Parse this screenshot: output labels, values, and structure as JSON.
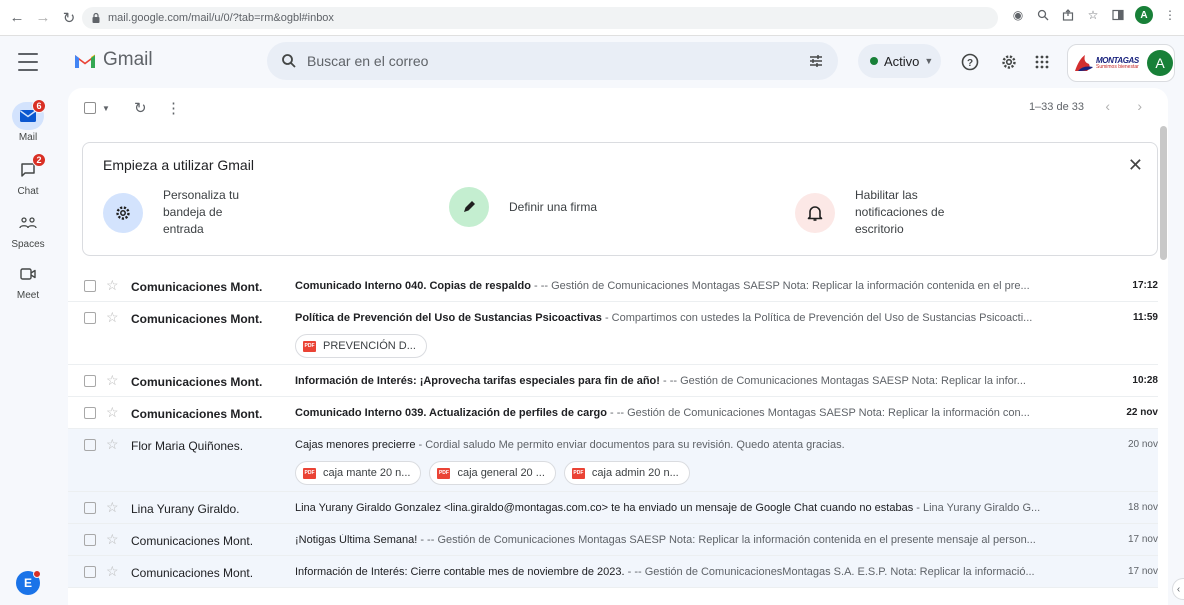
{
  "browser": {
    "url": "mail.google.com/mail/u/0/?tab=rm&ogbl#inbox",
    "avatar_letter": "A"
  },
  "header": {
    "app_name": "Gmail",
    "search_placeholder": "Buscar en el correo",
    "status_label": "Activo",
    "brand_name": "MONTAGAS",
    "brand_tagline": "Sumimos bienestar",
    "avatar_letter": "A"
  },
  "rail": {
    "items": [
      {
        "label": "Mail",
        "badge": "6",
        "icon": "mail-icon"
      },
      {
        "label": "Chat",
        "badge": "2",
        "icon": "chat-icon"
      },
      {
        "label": "Spaces",
        "icon": "spaces-icon"
      },
      {
        "label": "Meet",
        "icon": "meet-icon"
      }
    ],
    "bottom_avatar_letter": "E"
  },
  "toolbar": {
    "pagination": "1–33 de 33"
  },
  "setup_card": {
    "title": "Empieza a utilizar Gmail",
    "tasks": [
      {
        "label_lines": [
          "Personaliza tu",
          "bandeja de",
          "entrada"
        ],
        "icon": "gear-icon"
      },
      {
        "label_lines": [
          "Definir una firma"
        ],
        "icon": "pen-icon"
      },
      {
        "label_lines": [
          "Habilitar las",
          "notificaciones de",
          "escritorio"
        ],
        "icon": "bell-icon"
      }
    ]
  },
  "emails": [
    {
      "sender": "Comunicaciones Mont.",
      "subject": "Comunicado Interno 040. Copias de respaldo",
      "snippet": " - -- Gestión de Comunicaciones Montagas SAESP Nota: Replicar la información contenida en el pre...",
      "time": "17:12",
      "unread": true,
      "attachments": []
    },
    {
      "sender": "Comunicaciones Mont.",
      "subject": "Política de Prevención del Uso de Sustancias Psicoactivas",
      "snippet": " - Compartimos con ustedes la Política de Prevención del Uso de Sustancias Psicoacti...",
      "time": "11:59",
      "unread": true,
      "attachments": [
        "PREVENCIÓN D..."
      ]
    },
    {
      "sender": "Comunicaciones Mont.",
      "subject": "Información de Interés: ¡Aprovecha tarifas especiales para fin de año!",
      "snippet": " - -- Gestión de Comunicaciones Montagas SAESP Nota: Replicar la infor...",
      "time": "10:28",
      "unread": true,
      "attachments": []
    },
    {
      "sender": "Comunicaciones Mont.",
      "subject": "Comunicado Interno 039. Actualización de perfiles de cargo",
      "snippet": " - -- Gestión de Comunicaciones Montagas SAESP Nota: Replicar la información con...",
      "time": "22 nov",
      "unread": true,
      "attachments": []
    },
    {
      "sender": "Flor Maria Quiñones.",
      "subject": "Cajas menores precierre",
      "snippet": " - Cordial saludo Me permito enviar documentos para su revisión. Quedo atenta gracias.",
      "time": "20 nov",
      "unread": false,
      "attachments": [
        "caja mante 20 n...",
        "caja general 20 ...",
        "caja admin 20 n..."
      ]
    },
    {
      "sender": "Lina Yurany Giraldo.",
      "subject": "Lina Yurany Giraldo Gonzalez <lina.giraldo@montagas.com.co> te ha enviado un mensaje de Google Chat cuando no estabas",
      "snippet": " - Lina Yurany Giraldo G...",
      "time": "18 nov",
      "unread": false,
      "attachments": []
    },
    {
      "sender": "Comunicaciones Mont.",
      "subject": "¡Notigas Última Semana!",
      "snippet": " - -- Gestión de Comunicaciones Montagas SAESP Nota: Replicar la información contenida en el presente mensaje al person...",
      "time": "17 nov",
      "unread": false,
      "attachments": []
    },
    {
      "sender": "Comunicaciones Mont.",
      "subject": "Información de Interés: Cierre contable mes de noviembre de 2023.",
      "snippet": " - -- Gestión de ComunicacionesMontagas S.A. E.S.P. Nota: Replicar la informació...",
      "time": "17 nov",
      "unread": false,
      "attachments": []
    }
  ]
}
